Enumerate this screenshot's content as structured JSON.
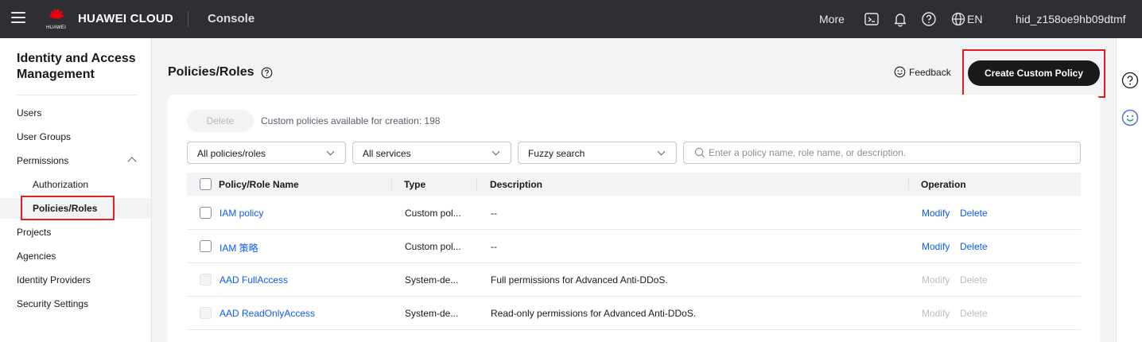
{
  "topbar": {
    "logo_text": "HUAWEI",
    "brand": "HUAWEI CLOUD",
    "console": "Console",
    "more": "More",
    "lang": "EN",
    "user": "hid_z158oe9hb09dtmf"
  },
  "sidebar": {
    "title": "Identity and Access Management",
    "items": [
      {
        "label": "Users"
      },
      {
        "label": "User Groups"
      },
      {
        "label": "Permissions"
      },
      {
        "label": "Authorization"
      },
      {
        "label": "Policies/Roles"
      },
      {
        "label": "Projects"
      },
      {
        "label": "Agencies"
      },
      {
        "label": "Identity Providers"
      },
      {
        "label": "Security Settings"
      }
    ]
  },
  "main": {
    "title": "Policies/Roles",
    "feedback": "Feedback",
    "create_button": "Create Custom Policy",
    "delete_button": "Delete",
    "quota_text": "Custom policies available for creation: 198",
    "filters": {
      "policies": "All policies/roles",
      "services": "All services",
      "search_mode": "Fuzzy search",
      "search_placeholder": "Enter a policy name, role name, or description."
    },
    "table": {
      "headers": {
        "name": "Policy/Role Name",
        "type": "Type",
        "description": "Description",
        "operation": "Operation"
      },
      "rows": [
        {
          "name": "IAM policy",
          "type": "Custom pol...",
          "description": "--",
          "modify": "Modify",
          "delete": "Delete"
        },
        {
          "name": "IAM 策略",
          "type": "Custom pol...",
          "description": "--",
          "modify": "Modify",
          "delete": "Delete"
        },
        {
          "name": "AAD FullAccess",
          "type": "System-de...",
          "description": "Full permissions for Advanced Anti-DDoS.",
          "modify": "Modify",
          "delete": "Delete"
        },
        {
          "name": "AAD ReadOnlyAccess",
          "type": "System-de...",
          "description": "Read-only permissions for Advanced Anti-DDoS.",
          "modify": "Modify",
          "delete": "Delete"
        }
      ]
    }
  },
  "colors": {
    "topbar_bg": "#2d2f33",
    "link": "#0a59f7",
    "primary_button": "#191919",
    "highlight": "#e02020",
    "logo_red": "#e60012"
  }
}
